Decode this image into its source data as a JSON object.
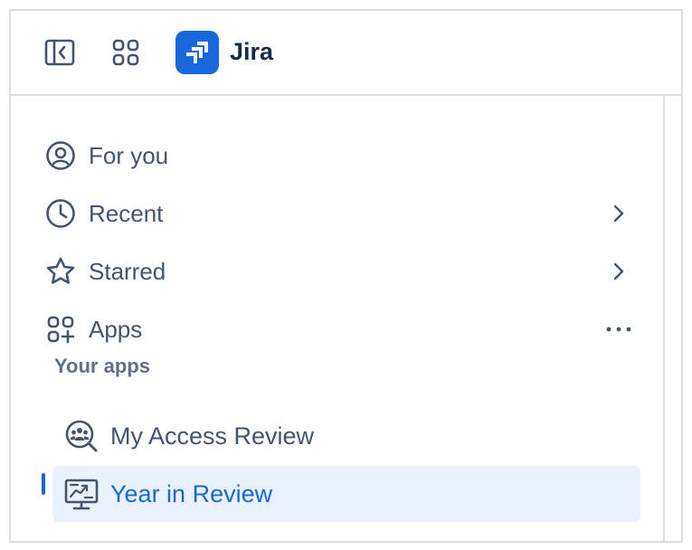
{
  "header": {
    "product_name": "Jira",
    "icons": [
      "sidebar-collapse-icon",
      "app-switcher-icon",
      "jira-logo-icon"
    ],
    "brand_color": "#1868db"
  },
  "nav": {
    "items": [
      {
        "label": "For you",
        "icon": "person-circle-icon"
      },
      {
        "label": "Recent",
        "icon": "clock-icon",
        "trail": "chevron-right-icon"
      },
      {
        "label": "Starred",
        "icon": "star-icon",
        "trail": "chevron-right-icon"
      },
      {
        "label": "Apps",
        "icon": "apps-add-icon",
        "trail": "more-icon"
      }
    ]
  },
  "apps": {
    "section_title": "Your apps",
    "items": [
      {
        "label": "My Access Review",
        "icon": "access-review-icon"
      },
      {
        "label": "Year in Review",
        "icon": "year-review-icon",
        "selected": true
      }
    ]
  },
  "colors": {
    "text": "#44546f",
    "selected_bg": "#e9f2fe",
    "selected_text": "#1868db",
    "border": "#dcdfe4"
  }
}
